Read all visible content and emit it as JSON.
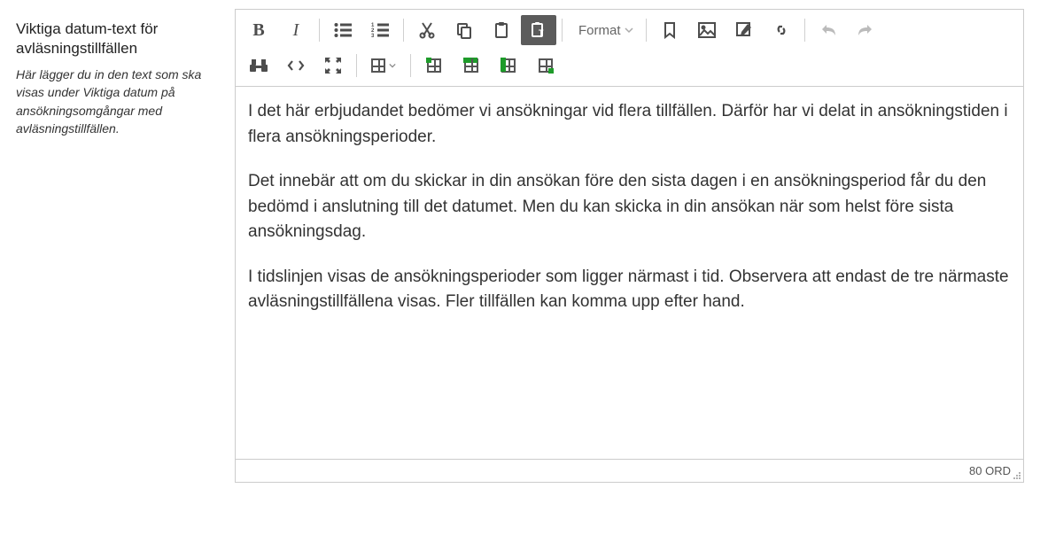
{
  "sidebar": {
    "title": "Viktiga datum-text för avläsningstillfällen",
    "description": "Här lägger du in den text som ska visas under Viktiga datum på ansökningsomgångar med avläsningstillfällen."
  },
  "toolbar": {
    "format_label": "Format"
  },
  "content": {
    "p1": "I det här erbjudandet bedömer vi ansökningar vid flera tillfällen. Därför har vi delat in ansökningstiden i flera ansökningsperioder.",
    "p2": "Det innebär att om du skickar in din ansökan före den sista dagen i en ansökningsperiod får du den bedömd i anslutning till det datumet. Men du kan skicka in din ansökan när som helst före sista ansökningsdag.",
    "p3": "I tidslinjen visas de ansökningsperioder som ligger närmast i tid. Observera att endast de tre närmaste avläsningstillfällena visas. Fler tillfällen kan komma upp efter hand."
  },
  "status": {
    "word_count_label": "80 ORD"
  }
}
